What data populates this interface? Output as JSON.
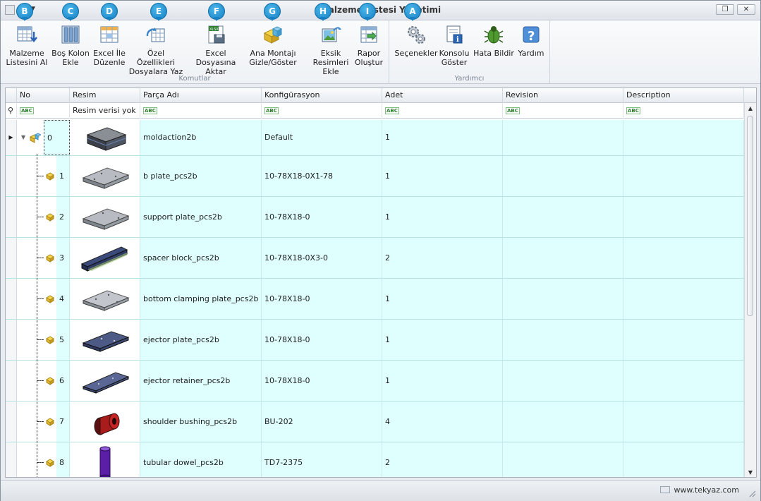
{
  "window": {
    "title": "Malzeme Listesi Yönetimi",
    "buttons": [
      "restore",
      "close"
    ]
  },
  "ribbon": {
    "groups": [
      {
        "label": "Komutlar",
        "buttons": [
          {
            "label": "Malzeme\nListesini Al",
            "badge": "B"
          },
          {
            "label": "Boş Kolon\nEkle",
            "badge": "C"
          },
          {
            "label": "Excel İle\nDüzenle",
            "badge": "D"
          },
          {
            "label": "Özel Özellikleri\nDosyalara Yaz",
            "badge": "E"
          },
          {
            "label": "Excel Dosyasına\nAktar",
            "badge": "F"
          },
          {
            "label": "Ana Montajı\nGizle/Göster",
            "badge": "G"
          },
          {
            "label": "Eksik\nResimleri Ekle",
            "badge": "H"
          },
          {
            "label": "Rapor\nOluştur",
            "badge": "I"
          }
        ]
      },
      {
        "label": "Yardımcı",
        "buttons": [
          {
            "label": "Seçenekler",
            "badge": "A"
          },
          {
            "label": "Konsolu\nGöster",
            "badge": ""
          },
          {
            "label": "Hata Bildir",
            "badge": ""
          },
          {
            "label": "Yardım",
            "badge": ""
          }
        ]
      }
    ]
  },
  "grid": {
    "columns": [
      "No",
      "Resim",
      "Parça Adı",
      "Konfigürasyon",
      "Adet",
      "Revision",
      "Description"
    ],
    "filter_row": {
      "resim": "Resim verisi yok"
    },
    "rows": [
      {
        "no": "0",
        "part": "moldaction2b",
        "config": "Default",
        "qty": "1",
        "revision": "",
        "description": ""
      },
      {
        "no": "1",
        "part": "b plate_pcs2b",
        "config": "10-78X18-0X1-78",
        "qty": "1",
        "revision": "",
        "description": ""
      },
      {
        "no": "2",
        "part": "support plate_pcs2b",
        "config": "10-78X18-0",
        "qty": "1",
        "revision": "",
        "description": ""
      },
      {
        "no": "3",
        "part": "spacer block_pcs2b",
        "config": "10-78X18-0X3-0",
        "qty": "2",
        "revision": "",
        "description": ""
      },
      {
        "no": "4",
        "part": "bottom clamping plate_pcs2b",
        "config": "10-78X18-0",
        "qty": "1",
        "revision": "",
        "description": ""
      },
      {
        "no": "5",
        "part": "ejector plate_pcs2b",
        "config": "10-78X18-0",
        "qty": "1",
        "revision": "",
        "description": ""
      },
      {
        "no": "6",
        "part": "ejector retainer_pcs2b",
        "config": "10-78X18-0",
        "qty": "1",
        "revision": "",
        "description": ""
      },
      {
        "no": "7",
        "part": "shoulder bushing_pcs2b",
        "config": "BU-202",
        "qty": "4",
        "revision": "",
        "description": ""
      },
      {
        "no": "8",
        "part": "tubular dowel_pcs2b",
        "config": "TD7-2375",
        "qty": "2",
        "revision": "",
        "description": ""
      }
    ]
  },
  "status": {
    "link": "www.tekyaz.com"
  }
}
